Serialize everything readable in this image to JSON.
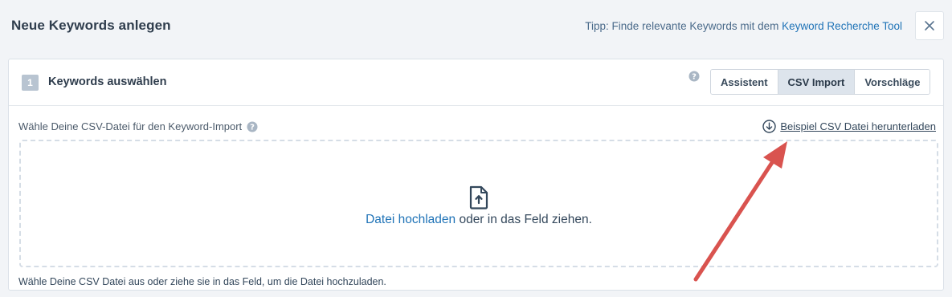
{
  "header": {
    "title": "Neue Keywords anlegen",
    "tip_prefix": "Tipp: Finde relevante Keywords mit dem",
    "tip_link": "Keyword Recherche Tool",
    "close_icon": "close-icon"
  },
  "card": {
    "step_number": "1",
    "step_title": "Keywords auswählen",
    "help_icon": "question-circle-icon",
    "tabs": [
      {
        "label": "Assistent",
        "active": false
      },
      {
        "label": "CSV Import",
        "active": true
      },
      {
        "label": "Vorschläge",
        "active": false
      }
    ],
    "field_label": "Wähle Deine CSV-Datei für den Keyword-Import",
    "download_label": "Beispiel CSV Datei herunterladen",
    "download_icon": "download-circle-icon",
    "dropzone": {
      "upload_icon": "file-upload-icon",
      "link_text": "Datei hochladen",
      "rest_text": " oder in das Feld ziehen."
    },
    "hint": "Wähle Deine CSV Datei aus oder ziehe sie in das Feld, um die Datei hochzuladen."
  },
  "annotation": {
    "arrow_color": "#d9534f",
    "type": "red-arrow"
  },
  "colors": {
    "accent": "#1f73b7",
    "active_tab_bg": "#dde4ec",
    "badge": "#b8c4d1"
  }
}
